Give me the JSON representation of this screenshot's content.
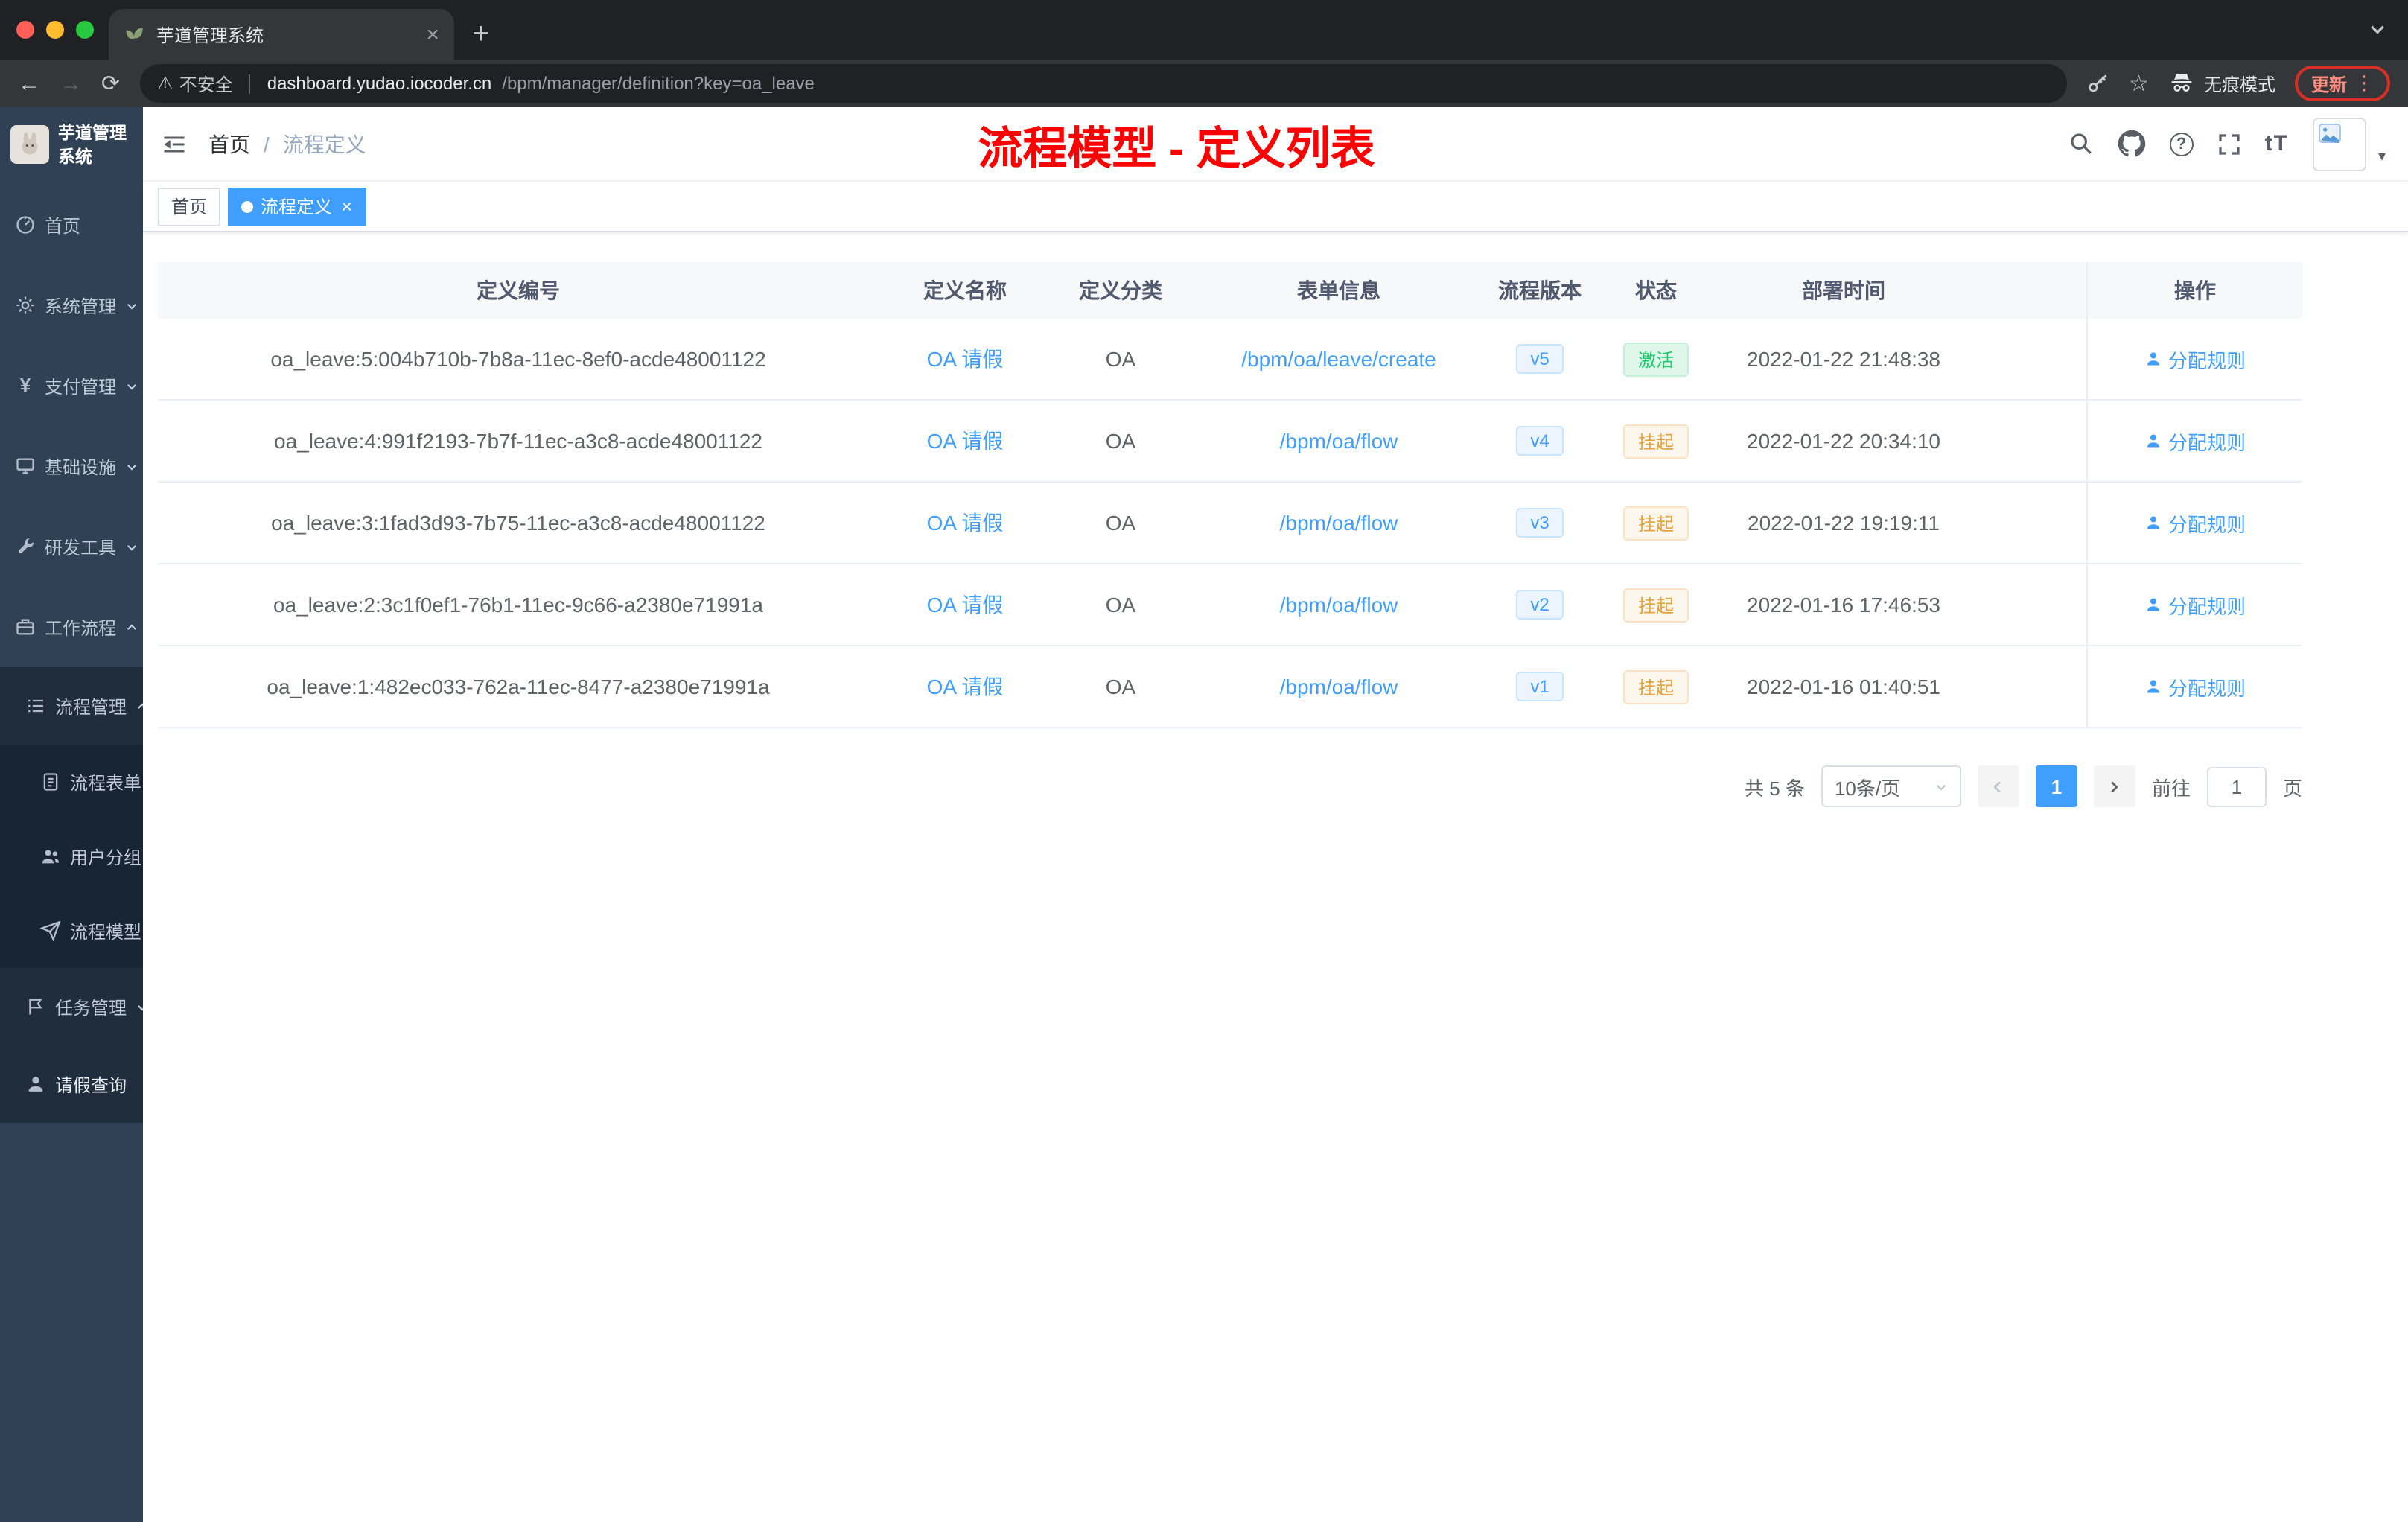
{
  "browser": {
    "tab_title": "芋道管理系统",
    "security_label": "不安全",
    "url_host": "dashboard.yudao.iocoder.cn",
    "url_path": "/bpm/manager/definition?key=oa_leave",
    "incognito_label": "无痕模式",
    "update_label": "更新"
  },
  "sidebar": {
    "logo_title": "芋道管理系统",
    "items": [
      {
        "label": "首页"
      },
      {
        "label": "系统管理"
      },
      {
        "label": "支付管理"
      },
      {
        "label": "基础设施"
      },
      {
        "label": "研发工具"
      },
      {
        "label": "工作流程"
      },
      {
        "label": "流程管理"
      },
      {
        "label": "流程表单"
      },
      {
        "label": "用户分组"
      },
      {
        "label": "流程模型"
      },
      {
        "label": "任务管理"
      },
      {
        "label": "请假查询"
      }
    ]
  },
  "header": {
    "breadcrumb": [
      "首页",
      "流程定义"
    ],
    "annotation": "流程模型 - 定义列表",
    "font_size_tool": "tT"
  },
  "tags": [
    {
      "label": "首页"
    },
    {
      "label": "流程定义"
    }
  ],
  "table": {
    "columns": [
      "定义编号",
      "定义名称",
      "定义分类",
      "表单信息",
      "流程版本",
      "状态",
      "部署时间",
      "操作"
    ],
    "action_label": "分配规则",
    "rows": [
      {
        "id": "oa_leave:5:004b710b-7b8a-11ec-8ef0-acde48001122",
        "name": "OA 请假",
        "category": "OA",
        "form": "/bpm/oa/leave/create",
        "version": "v5",
        "status": "激活",
        "time": "2022-01-22 21:48:38"
      },
      {
        "id": "oa_leave:4:991f2193-7b7f-11ec-a3c8-acde48001122",
        "name": "OA 请假",
        "category": "OA",
        "form": "/bpm/oa/flow",
        "version": "v4",
        "status": "挂起",
        "time": "2022-01-22 20:34:10"
      },
      {
        "id": "oa_leave:3:1fad3d93-7b75-11ec-a3c8-acde48001122",
        "name": "OA 请假",
        "category": "OA",
        "form": "/bpm/oa/flow",
        "version": "v3",
        "status": "挂起",
        "time": "2022-01-22 19:19:11"
      },
      {
        "id": "oa_leave:2:3c1f0ef1-76b1-11ec-9c66-a2380e71991a",
        "name": "OA 请假",
        "category": "OA",
        "form": "/bpm/oa/flow",
        "version": "v2",
        "status": "挂起",
        "time": "2022-01-16 17:46:53"
      },
      {
        "id": "oa_leave:1:482ec033-762a-11ec-8477-a2380e71991a",
        "name": "OA 请假",
        "category": "OA",
        "form": "/bpm/oa/flow",
        "version": "v1",
        "status": "挂起",
        "time": "2022-01-16 01:40:51"
      }
    ]
  },
  "pagination": {
    "total_label": "共 5 条",
    "page_size_label": "10条/页",
    "current_page": "1",
    "goto_label": "前往",
    "goto_value": "1",
    "page_unit_label": "页"
  },
  "colors": {
    "accent_blue": "#409eff",
    "status_active_green": "#13ce66",
    "status_suspended_orange": "#e6a23c",
    "annotation_red": "#fe0000",
    "sidebar_bg": "#304156",
    "sidebar_submenu_bg": "#1f2d3d"
  }
}
